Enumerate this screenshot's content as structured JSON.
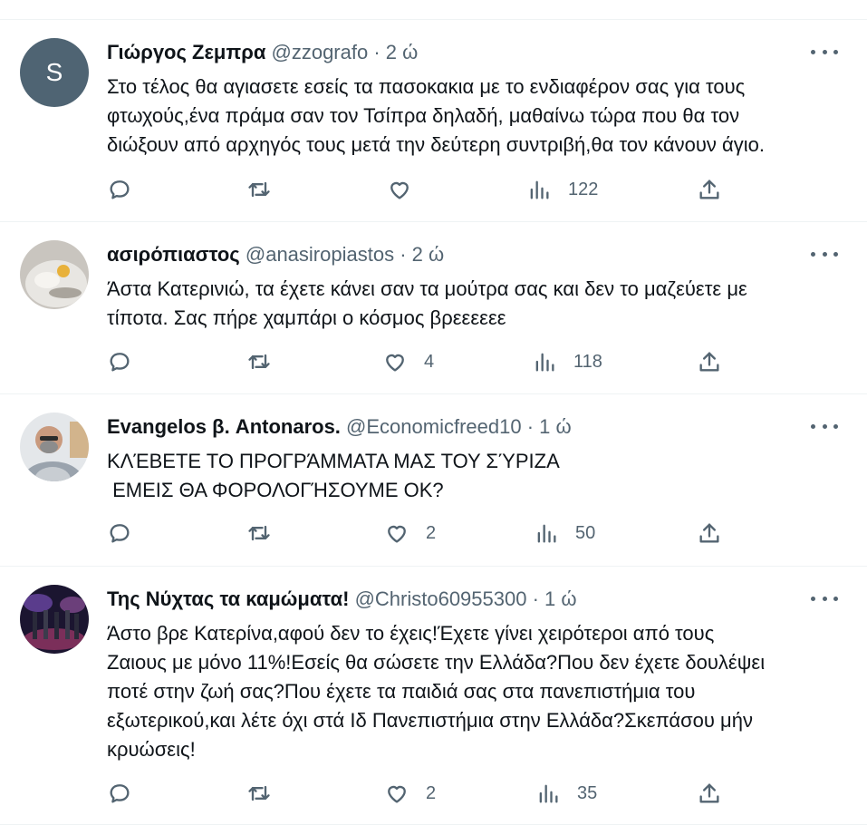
{
  "tweets": [
    {
      "name": "Γιώργος Ζεμπρα",
      "handle": "@zzografo",
      "separator": "·",
      "time": "2 ώ",
      "avatar_letter": "S",
      "lines": [
        "Στο τέλος θα αγιασετε εσείς τα πασοκακια με το ενδιαφέρον σας για τους",
        "φτωχούς,ένα πράμα σαν τον Τσίπρα δηλαδή, μαθαίνω τώρα που θα τον",
        "διώξουν από αρχηγός τους μετά την δεύτερη συντριβή,θα τον κάνουν άγιο."
      ],
      "likes": "",
      "views": "122"
    },
    {
      "name": "ασιρόπιαστος",
      "handle": "@anasiropiastos",
      "separator": "·",
      "time": "2 ώ",
      "lines": [
        "Άστα Κατερινιώ, τα έχετε κάνει σαν τα μούτρα σας και δεν το μαζεύετε με",
        "τίποτα. Σας πήρε χαμπάρι ο κόσμος βρεεεεεε"
      ],
      "likes": "4",
      "views": "118"
    },
    {
      "name": "Evangelos β. Antonaros.",
      "handle": "@Economicfreed10",
      "separator": "·",
      "time": "1 ώ",
      "lines": [
        "ΚΛΈΒΕΤΕ ΤΟ ΠΡΟΓΡΆΜΜΑΤΑ ΜΑΣ ΤΟΥ ΣΎΡΙΖΑ",
        " ΕΜΕΙΣ ΘΑ ΦΟΡΟΛΟΓΉΣΟΥΜΕ ΟΚ?"
      ],
      "likes": "2",
      "views": "50"
    },
    {
      "name": "Της Νύχτας τα καμώματα!",
      "handle": "@Christo60955300",
      "separator": "·",
      "time": "1 ώ",
      "lines": [
        "Άστο βρε Κατερίνα,αφού δεν το έχεις!Έχετε γίνει χειρότεροι από τους",
        "Ζαιους με μόνο 11%!Εσείς θα σώσετε την Ελλάδα?Που δεν έχετε δουλέψει",
        "ποτέ στην ζωή σας?Που έχετε τα παιδιά σας στα πανεπιστήμια του",
        "εξωτερικού,και λέτε όχι στά Ιδ Πανεπιστήμια στην Ελλάδα?Σκεπάσου μήν",
        "κρυώσεις!"
      ],
      "likes": "2",
      "views": "35"
    }
  ],
  "icons": [
    "reply-icon",
    "retweet-icon",
    "like-icon",
    "views-icon",
    "share-icon",
    "more-icon"
  ],
  "colors": {
    "text": "#0f1419",
    "secondary": "#536471",
    "divider": "#eff3f4",
    "avatar_bg": "#4f6473"
  }
}
